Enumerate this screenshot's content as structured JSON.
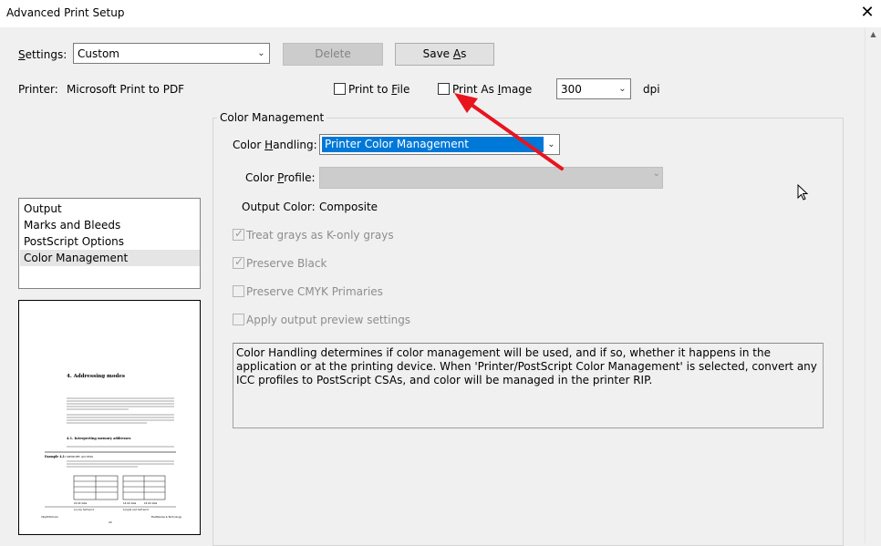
{
  "window": {
    "title": "Advanced Print Setup",
    "close_glyph": "✕"
  },
  "settings": {
    "label": "Settings:",
    "value": "Custom",
    "delete_label": "Delete",
    "save_as_label": "Save As"
  },
  "printer": {
    "label": "Printer:",
    "value": "Microsoft Print to PDF",
    "print_to_file_label": "Print to File",
    "print_as_image_label": "Print As Image",
    "dpi_value": "300",
    "dpi_unit": "dpi"
  },
  "nav": {
    "items": [
      {
        "label": "Output"
      },
      {
        "label": "Marks and Bleeds"
      },
      {
        "label": "PostScript Options"
      },
      {
        "label": "Color Management"
      }
    ],
    "selected": "Color Management"
  },
  "color_management": {
    "group_title": "Color Management",
    "handling_label": "Color Handling:",
    "handling_value": "Printer Color Management",
    "profile_label": "Color Profile:",
    "profile_value": "",
    "output_color_label": "Output Color:",
    "output_color_value": "Composite",
    "options": [
      {
        "label": "Treat grays as K-only grays",
        "checked": true,
        "enabled": false
      },
      {
        "label": "Preserve Black",
        "checked": true,
        "enabled": false
      },
      {
        "label": "Preserve CMYK Primaries",
        "checked": false,
        "enabled": false
      },
      {
        "label": "Apply output preview settings",
        "checked": false,
        "enabled": false
      }
    ],
    "description": "Color Handling determines if color management will be used, and if so, whether it happens in the application or at the printing device. When 'Printer/PostScript Color Management' is selected, convert any ICC profiles to PostScript CSAs, and color will be managed in the printer RIP."
  },
  "preview_page": {
    "heading": "4. Addressing modes",
    "subheading": "4.1. Interpreting memory addresses",
    "example_label": "Example 4.1:",
    "example_title": "MEMORY ACCESS",
    "table_captions": [
      "16 bit data",
      "16 bit data",
      "16 bit data"
    ],
    "caption_a": "a) only half word",
    "caption_b": "b) byte and half word",
    "footer_left": "Villy/Dithmann",
    "footer_page": "22",
    "footer_right": "Elsoftwares & Technology"
  },
  "colors": {
    "accent": "#0078d7",
    "annotation_arrow": "#e8141e",
    "background": "#f0f0f0"
  }
}
